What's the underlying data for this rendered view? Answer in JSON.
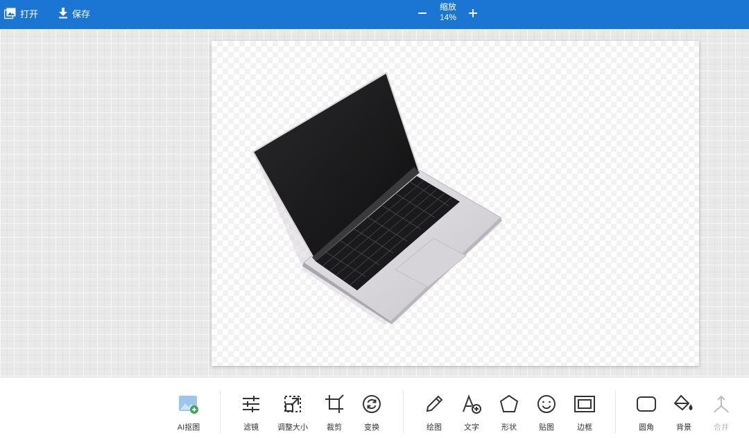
{
  "topbar": {
    "open_label": "打开",
    "save_label": "保存",
    "zoom_label": "缩放",
    "zoom_value": "14%",
    "background_color": "#1b76d3"
  },
  "tools": [
    {
      "key": "ai-cutout",
      "label": "AI抠图",
      "icon": "ai-cutout-icon",
      "enabled": true
    },
    {
      "key": "filter",
      "label": "滤镜",
      "icon": "sliders-icon",
      "enabled": true
    },
    {
      "key": "resize",
      "label": "调整大小",
      "icon": "resize-icon",
      "enabled": true
    },
    {
      "key": "crop",
      "label": "裁剪",
      "icon": "crop-icon",
      "enabled": true
    },
    {
      "key": "transform",
      "label": "变换",
      "icon": "rotate-icon",
      "enabled": true
    },
    {
      "key": "draw",
      "label": "绘图",
      "icon": "pencil-icon",
      "enabled": true
    },
    {
      "key": "text",
      "label": "文字",
      "icon": "text-add-icon",
      "enabled": true
    },
    {
      "key": "shape",
      "label": "形状",
      "icon": "pentagon-icon",
      "enabled": true
    },
    {
      "key": "sticker",
      "label": "贴图",
      "icon": "smiley-icon",
      "enabled": true
    },
    {
      "key": "frame",
      "label": "边框",
      "icon": "frame-icon",
      "enabled": true
    },
    {
      "key": "corners",
      "label": "圆角",
      "icon": "rounded-rect-icon",
      "enabled": true
    },
    {
      "key": "background",
      "label": "背景",
      "icon": "paint-bucket-icon",
      "enabled": true
    },
    {
      "key": "merge",
      "label": "合并",
      "icon": "merge-icon",
      "enabled": false
    }
  ],
  "canvas": {
    "image": "laptop photo on transparent background"
  }
}
